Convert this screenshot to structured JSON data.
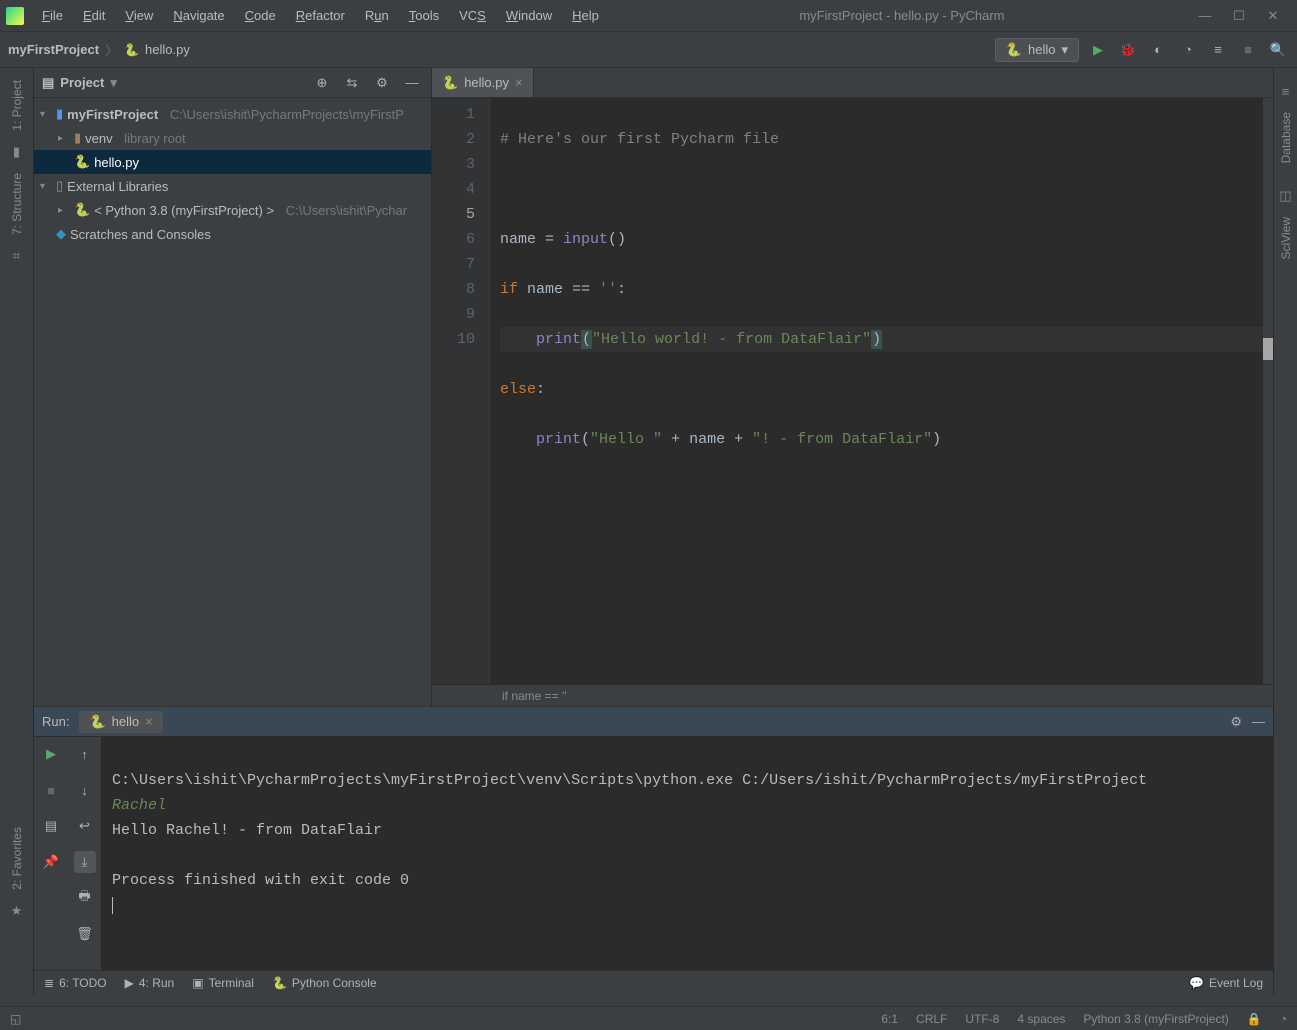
{
  "window": {
    "title": "myFirstProject - hello.py - PyCharm"
  },
  "menu": [
    "File",
    "Edit",
    "View",
    "Navigate",
    "Code",
    "Refactor",
    "Run",
    "Tools",
    "VCS",
    "Window",
    "Help"
  ],
  "breadcrumb": {
    "project": "myFirstProject",
    "file": "hello.py"
  },
  "runConfig": {
    "name": "hello"
  },
  "leftTools": {
    "project": "1: Project",
    "structure": "7: Structure",
    "favorites": "2: Favorites"
  },
  "rightTools": {
    "database": "Database",
    "sciview": "SciView"
  },
  "projectPanel": {
    "title": "Project",
    "tree": {
      "root": {
        "name": "myFirstProject",
        "path": "C:\\Users\\ishit\\PycharmProjects\\myFirstP"
      },
      "venv": {
        "name": "venv",
        "note": "library root"
      },
      "file": {
        "name": "hello.py"
      },
      "extlib": {
        "name": "External Libraries"
      },
      "python": {
        "label": "< Python 3.8 (myFirstProject) >",
        "path": "C:\\Users\\ishit\\Pychar"
      },
      "scratches": {
        "name": "Scratches and Consoles"
      }
    }
  },
  "editor": {
    "tab": "hello.py",
    "gutter": [
      "1",
      "2",
      "3",
      "4",
      "5",
      "6",
      "7",
      "8",
      "9",
      "10"
    ],
    "currentLine": 5,
    "breadcrumb": "if name == ''",
    "code": {
      "l1": "# Here's our first Pycharm file",
      "l3a": "name = ",
      "l3b": "input",
      "l3c": "()",
      "l4a": "if ",
      "l4b": "name == ",
      "l4c": "''",
      "l4d": ":",
      "l5a": "    ",
      "l5b": "print",
      "l5c": "(",
      "l5d": "\"Hello world! - from DataFlair\"",
      "l5e": ")",
      "l6a": "else",
      "l6b": ":",
      "l7a": "    ",
      "l7b": "print",
      "l7c": "(",
      "l7d": "\"Hello \"",
      "l7e": " + name + ",
      "l7f": "\"! - from DataFlair\"",
      "l7g": ")"
    }
  },
  "runPanel": {
    "title": "Run:",
    "tab": "hello",
    "console": {
      "cmd": "C:\\Users\\ishit\\PycharmProjects\\myFirstProject\\venv\\Scripts\\python.exe C:/Users/ishit/PycharmProjects/myFirstProject",
      "input": "Rachel",
      "out": "Hello Rachel! - from DataFlair",
      "exit": "Process finished with exit code 0"
    }
  },
  "bottomTools": {
    "todo": "6: TODO",
    "run": "4: Run",
    "terminal": "Terminal",
    "pyconsole": "Python Console",
    "eventlog": "Event Log"
  },
  "status": {
    "pos": "6:1",
    "le": "CRLF",
    "enc": "UTF-8",
    "indent": "4 spaces",
    "interp": "Python 3.8 (myFirstProject)"
  }
}
